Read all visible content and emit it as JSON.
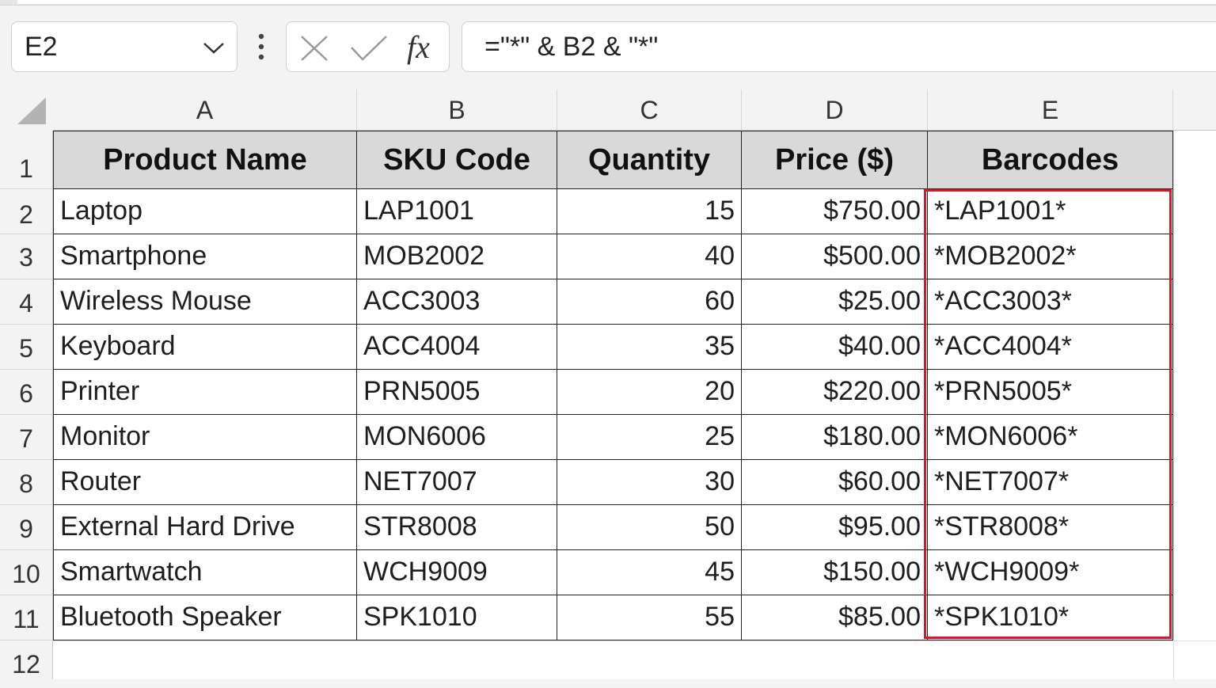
{
  "name_box": {
    "value": "E2",
    "icon": "chevron-down-icon"
  },
  "formula_bar": {
    "cancel_icon": "close-icon",
    "enter_icon": "check-icon",
    "fx_label": "fx",
    "formula": "=\"*\" & B2 & \"*\""
  },
  "columns": [
    "A",
    "B",
    "C",
    "D",
    "E"
  ],
  "rows": [
    "1",
    "2",
    "3",
    "4",
    "5",
    "6",
    "7",
    "8",
    "9",
    "10",
    "11",
    "12"
  ],
  "table": {
    "headers": [
      "Product Name",
      "SKU Code",
      "Quantity",
      "Price ($)",
      "Barcodes"
    ],
    "rows": [
      [
        "Laptop",
        "LAP1001",
        "15",
        "$750.00",
        "*LAP1001*"
      ],
      [
        "Smartphone",
        "MOB2002",
        "40",
        "$500.00",
        "*MOB2002*"
      ],
      [
        "Wireless Mouse",
        "ACC3003",
        "60",
        "$25.00",
        "*ACC3003*"
      ],
      [
        "Keyboard",
        "ACC4004",
        "35",
        "$40.00",
        "*ACC4004*"
      ],
      [
        "Printer",
        "PRN5005",
        "20",
        "$220.00",
        "*PRN5005*"
      ],
      [
        "Monitor",
        "MON6006",
        "25",
        "$180.00",
        "*MON6006*"
      ],
      [
        "Router",
        "NET7007",
        "30",
        "$60.00",
        "*NET7007*"
      ],
      [
        "External Hard Drive",
        "STR8008",
        "50",
        "$95.00",
        "*STR8008*"
      ],
      [
        "Smartwatch",
        "WCH9009",
        "45",
        "$150.00",
        "*WCH9009*"
      ],
      [
        "Bluetooth Speaker",
        "SPK1010",
        "55",
        "$85.00",
        "*SPK1010*"
      ]
    ]
  },
  "colors": {
    "highlight_border": "#d8182a",
    "header_fill": "#d9d9d9"
  }
}
